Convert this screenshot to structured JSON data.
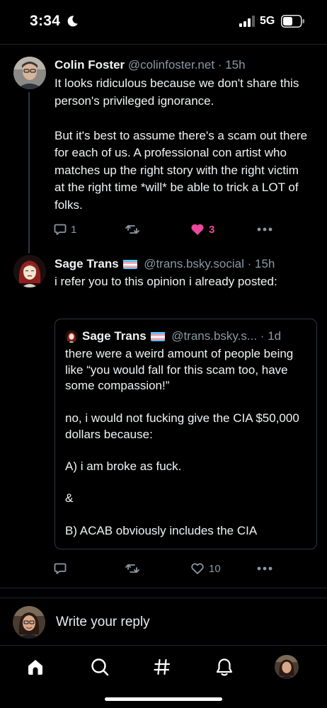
{
  "status_bar": {
    "time": "3:34",
    "network": "5G",
    "icons": [
      "moon-icon",
      "signal-icon",
      "battery-icon"
    ]
  },
  "posts": [
    {
      "display_name": "Colin Foster",
      "handle": "@colinfoster.net",
      "separator": "·",
      "time": "15h",
      "text": "It looks ridiculous because we don't share this person's privileged ignorance.\n\nBut it's best to assume there's a scam out there for each of us. A professional con artist who matches up the right story with the right victim at the right time *will* be able to trick a LOT of folks.",
      "reply_count": "1",
      "repost_count": "",
      "like_count": "3",
      "liked": true
    },
    {
      "display_name": "Sage Trans",
      "handle": "@trans.bsky.social",
      "separator": "·",
      "time": "15h",
      "text": "i refer you to this opinion i already posted:",
      "reply_count": "",
      "repost_count": "",
      "like_count": "10",
      "liked": false,
      "quote": {
        "display_name": "Sage Trans",
        "handle": "@trans.bsky.s...",
        "separator": "·",
        "time": "1d",
        "text": "there were a weird amount of people being like “you would fall for this scam too, have some compassion!”\n\nno, i would not fucking give the CIA $50,000 dollars because:\n\nA) i am broke as fuck.\n\n&\n\nB) ACAB obviously includes the CIA"
      }
    }
  ],
  "reply_bar": {
    "placeholder": "Write your reply"
  },
  "tab_bar": {
    "tabs": [
      "home-icon",
      "search-icon",
      "feeds-hash-icon",
      "notifications-bell-icon",
      "profile-avatar"
    ]
  },
  "colors": {
    "background": "#000000",
    "text": "#f1f3f5",
    "muted": "#8b98a5",
    "like_pink": "#ec4899",
    "border": "#2e3640"
  }
}
